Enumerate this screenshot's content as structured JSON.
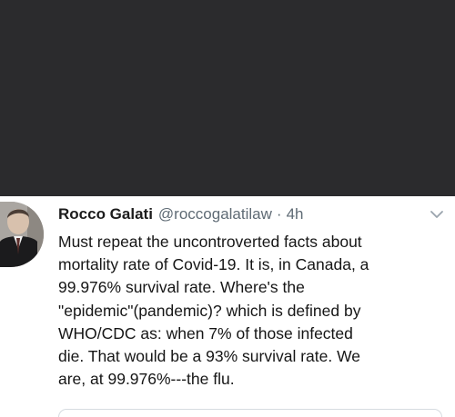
{
  "tweet": {
    "display_name": "Rocco Galati",
    "handle": "@roccogalatilaw",
    "separator": "·",
    "timestamp": "4h",
    "body_lines": [
      "Must repeat the uncontroverted facts about",
      "mortality rate of Covid-19.  It is, in Canada, a",
      "99.976% survival rate. Where's the",
      "\"epidemic\"(pandemic)? which is defined by",
      "WHO/CDC as: when 7% of those infected",
      "die. That would be a 93% survival rate. We",
      "are, at 99.976%---the flu."
    ],
    "avatar_icon": "user-avatar-photo",
    "menu_icon": "chevron-down-icon"
  },
  "colors": {
    "dark_band": "#2b2b2d",
    "name": "#1c1c1c",
    "secondary_text": "#5f6b75",
    "body_text": "#161616",
    "border": "#d6dbe0"
  }
}
